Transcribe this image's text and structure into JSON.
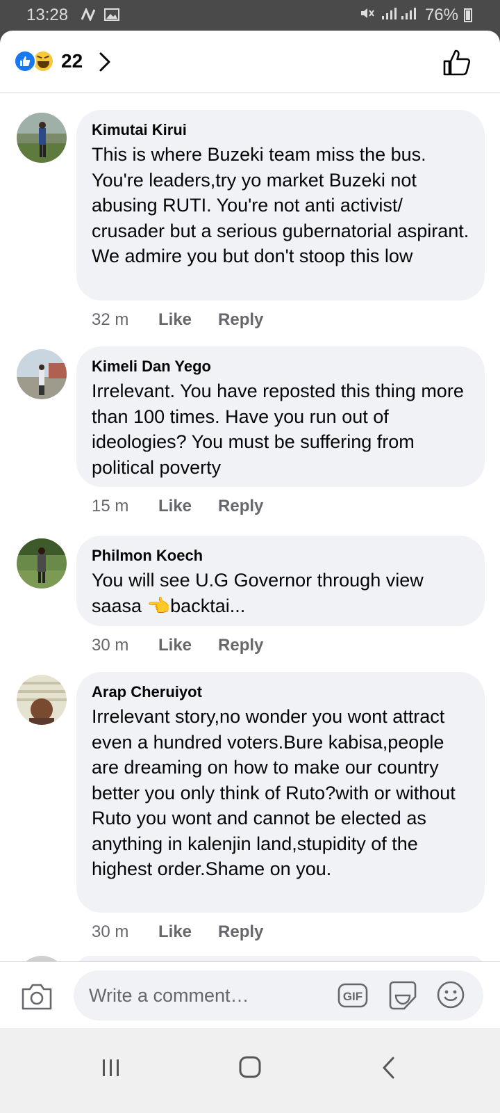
{
  "status_bar": {
    "time": "13:28",
    "battery": "76%"
  },
  "reactions": {
    "count": "22"
  },
  "comments": [
    {
      "author": "Kimutai Kirui",
      "text": "This is where Buzeki team miss the bus. You're leaders,try yo market Buzeki not abusing RUTI. You're not anti activist/ crusader but a serious gubernatorial aspirant. We admire you but don't stoop this low",
      "time": "32 m",
      "like": "Like",
      "reply": "Reply"
    },
    {
      "author": "Kimeli Dan Yego",
      "text": "Irrelevant. You have reposted this thing more than 100 times. Have you run out of ideologies? You must be suffering from political poverty",
      "time": "15 m",
      "like": "Like",
      "reply": "Reply"
    },
    {
      "author": "Philmon Koech",
      "text": "You will see U.G Governor through view saasa 👈backtai...",
      "time": "30 m",
      "like": "Like",
      "reply": "Reply"
    },
    {
      "author": "Arap Cheruiyot",
      "text": "Irrelevant story,no wonder you wont attract even a hundred voters.Bure kabisa,people are dreaming on how to make our country better  you only think of Ruto?with or without Ruto you wont and cannot be elected as anything in kalenjin land,stupidity of the highest order.Shame on you.",
      "time": "30 m",
      "like": "Like",
      "reply": "Reply"
    }
  ],
  "composer": {
    "placeholder": "Write a comment…"
  },
  "colors": {
    "accent": "#1877f2",
    "bubble": "#f0f2f5",
    "secondary_text": "#65676b"
  }
}
